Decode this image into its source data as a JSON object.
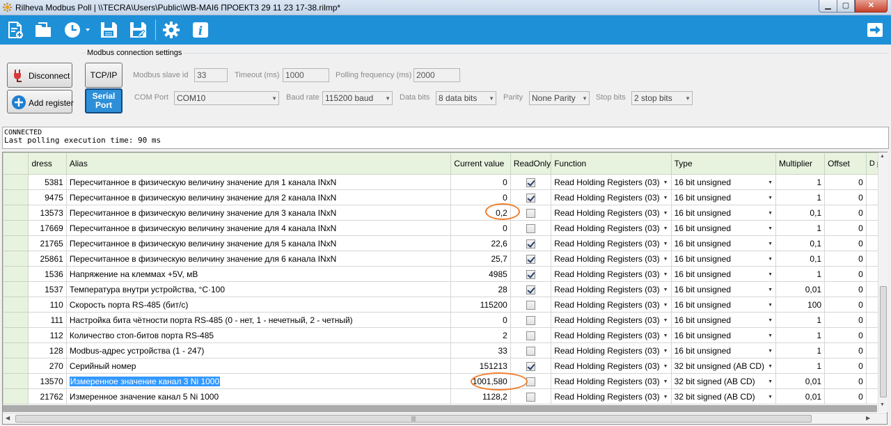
{
  "window": {
    "title": "Rilheva Modbus Poll | \\\\TECRA\\Users\\Public\\WB-MAI6 ПРОЕКТ3 29 11 23 17-38.rilmp*",
    "min": "▁",
    "max": "▢",
    "close": "✕"
  },
  "connection": {
    "legend": "Modbus connection settings",
    "disconnect_label": "Disconnect",
    "add_register_label": "Add register",
    "tcp_label": "TCP/IP",
    "serial_label": "Serial Port",
    "slave_id_label": "Modbus slave id",
    "slave_id": "33",
    "timeout_label": "Timeout (ms)",
    "timeout": "1000",
    "polling_label": "Polling frequency (ms)",
    "polling": "2000",
    "com_label": "COM Port",
    "com": "COM10",
    "baud_label": "Baud rate",
    "baud": "115200 baud",
    "databits_label": "Data bits",
    "databits": "8 data bits",
    "parity_label": "Parity",
    "parity": "None Parity",
    "stopbits_label": "Stop bits",
    "stopbits": "2 stop bits"
  },
  "status": {
    "line1": "CONNECTED",
    "line2": "Last polling execution time: 90 ms"
  },
  "grid": {
    "headers": {
      "address": "dress",
      "alias": "Alias",
      "current": "Current value",
      "readonly": "ReadOnly",
      "function": "Function",
      "type": "Type",
      "multiplier": "Multiplier",
      "offset": "Offset",
      "more": "D pl"
    },
    "rows": [
      {
        "address": "5381",
        "alias": "Пересчитанное в физическую величину значение для 1 канала INxN",
        "value": "0",
        "readonly": true,
        "function": "Read Holding Registers (03)",
        "type": "16 bit unsigned",
        "multiplier": "1",
        "offset": "0"
      },
      {
        "address": "9475",
        "alias": "Пересчитанное в физическую величину значение для 2 канала INxN",
        "value": "0",
        "readonly": true,
        "function": "Read Holding Registers (03)",
        "type": "16 bit unsigned",
        "multiplier": "1",
        "offset": "0"
      },
      {
        "address": "13573",
        "alias": "Пересчитанное в физическую величину значение для 3 канала INxN",
        "value": "0,2",
        "readonly": false,
        "function": "Read Holding Registers (03)",
        "type": "16 bit unsigned",
        "multiplier": "0,1",
        "offset": "0"
      },
      {
        "address": "17669",
        "alias": "Пересчитанное в физическую величину значение для 4 канала INxN",
        "value": "0",
        "readonly": false,
        "function": "Read Holding Registers (03)",
        "type": "16 bit unsigned",
        "multiplier": "1",
        "offset": "0"
      },
      {
        "address": "21765",
        "alias": "Пересчитанное в физическую величину значение для 5 канала INxN",
        "value": "22,6",
        "readonly": true,
        "function": "Read Holding Registers (03)",
        "type": "16 bit unsigned",
        "multiplier": "0,1",
        "offset": "0"
      },
      {
        "address": "25861",
        "alias": "Пересчитанное в физическую величину значение для 6 канала INxN",
        "value": "25,7",
        "readonly": true,
        "function": "Read Holding Registers (03)",
        "type": "16 bit unsigned",
        "multiplier": "0,1",
        "offset": "0"
      },
      {
        "address": "1536",
        "alias": "Напряжение на клеммах +5V, мВ",
        "value": "4985",
        "readonly": true,
        "function": "Read Holding Registers (03)",
        "type": "16 bit unsigned",
        "multiplier": "1",
        "offset": "0"
      },
      {
        "address": "1537",
        "alias": "Температура внутри устройства, °C·100",
        "value": "28",
        "readonly": true,
        "function": "Read Holding Registers (03)",
        "type": "16 bit unsigned",
        "multiplier": "0,01",
        "offset": "0"
      },
      {
        "address": "110",
        "alias": "Скорость порта RS-485 (бит/с)",
        "value": "115200",
        "readonly": false,
        "function": "Read Holding Registers (03)",
        "type": "16 bit unsigned",
        "multiplier": "100",
        "offset": "0"
      },
      {
        "address": "111",
        "alias": "Настройка бита чётности порта RS-485 (0 - нет, 1 - нечетный, 2 - четный)",
        "value": "0",
        "readonly": false,
        "function": "Read Holding Registers (03)",
        "type": "16 bit unsigned",
        "multiplier": "1",
        "offset": "0"
      },
      {
        "address": "112",
        "alias": "Количество стоп-битов порта RS-485",
        "value": "2",
        "readonly": false,
        "function": "Read Holding Registers (03)",
        "type": "16 bit unsigned",
        "multiplier": "1",
        "offset": "0"
      },
      {
        "address": "128",
        "alias": "Modbus-адрес устройства (1 - 247)",
        "value": "33",
        "readonly": false,
        "function": "Read Holding Registers (03)",
        "type": "16 bit unsigned",
        "multiplier": "1",
        "offset": "0"
      },
      {
        "address": "270",
        "alias": "Серийный номер",
        "value": "151213",
        "readonly": true,
        "function": "Read Holding Registers (03)",
        "type": "32 bit unsigned (AB CD)",
        "multiplier": "1",
        "offset": "0"
      },
      {
        "address": "13570",
        "alias": "Измеренное значение канал 3 Ni 1000",
        "value": "1001,580",
        "readonly": false,
        "function": "Read Holding Registers (03)",
        "type": "32 bit signed (AB CD)",
        "multiplier": "0,01",
        "offset": "0",
        "selected": true
      },
      {
        "address": "21762",
        "alias": "Измеренное значение канал 5 Ni 1000",
        "value": "1128,2",
        "readonly": false,
        "function": "Read Holding Registers (03)",
        "type": "32 bit signed (AB CD)",
        "multiplier": "0,01",
        "offset": "0"
      }
    ]
  },
  "toolbar": {
    "icons": [
      "new-register-file-icon",
      "open-folder-icon",
      "history-clock-icon",
      "save-icon",
      "save-as-icon",
      "settings-gear-icon",
      "info-icon",
      "exit-arrow-icon"
    ]
  },
  "colors": {
    "toolbar": "#1e90d8",
    "header": "#e8f3df",
    "highlight": "#3399ff",
    "annotation": "#f07e2d"
  }
}
